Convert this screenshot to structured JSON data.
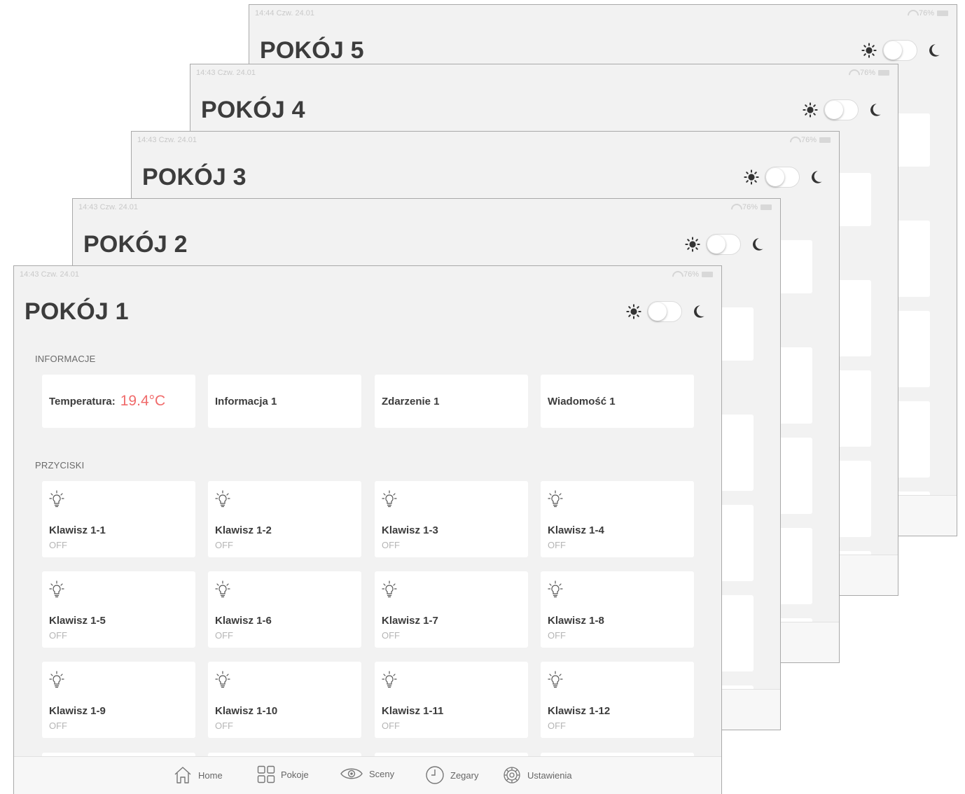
{
  "screens": [
    {
      "title": "POKÓJ 5",
      "status_left": "14:44  Czw. 24.01",
      "battery": "76%"
    },
    {
      "title": "POKÓJ 4",
      "status_left": "14:43  Czw. 24.01",
      "battery": "76%"
    },
    {
      "title": "POKÓJ 3",
      "status_left": "14:43  Czw. 24.01",
      "battery": "76%"
    },
    {
      "title": "POKÓJ 2",
      "status_left": "14:43  Czw. 24.01",
      "battery": "76%"
    },
    {
      "title": "POKÓJ 1",
      "status_left": "14:43  Czw. 24.01",
      "battery": "76%"
    }
  ],
  "main": {
    "info_section_label": "INFORMACJE",
    "temperature_label": "Temperatura:",
    "temperature_value": "19.4°C",
    "info_cards": [
      "Informacja 1",
      "Zdarzenie 1",
      "Wiadomość 1"
    ],
    "buttons_section_label": "PRZYCISKI",
    "buttons": [
      {
        "name": "Klawisz 1-1",
        "state": "OFF"
      },
      {
        "name": "Klawisz 1-2",
        "state": "OFF"
      },
      {
        "name": "Klawisz 1-3",
        "state": "OFF"
      },
      {
        "name": "Klawisz 1-4",
        "state": "OFF"
      },
      {
        "name": "Klawisz 1-5",
        "state": "OFF"
      },
      {
        "name": "Klawisz 1-6",
        "state": "OFF"
      },
      {
        "name": "Klawisz 1-7",
        "state": "OFF"
      },
      {
        "name": "Klawisz 1-8",
        "state": "OFF"
      },
      {
        "name": "Klawisz 1-9",
        "state": "OFF"
      },
      {
        "name": "Klawisz 1-10",
        "state": "OFF"
      },
      {
        "name": "Klawisz 1-11",
        "state": "OFF"
      },
      {
        "name": "Klawisz 1-12",
        "state": "OFF"
      }
    ]
  },
  "tabbar": {
    "home": "Home",
    "rooms": "Pokoje",
    "scenes": "Sceny",
    "clocks": "Zegary",
    "settings": "Ustawienia"
  },
  "colors": {
    "accent_temperature": "#f06b6b",
    "background": "#f2f2f2",
    "card": "#ffffff"
  }
}
